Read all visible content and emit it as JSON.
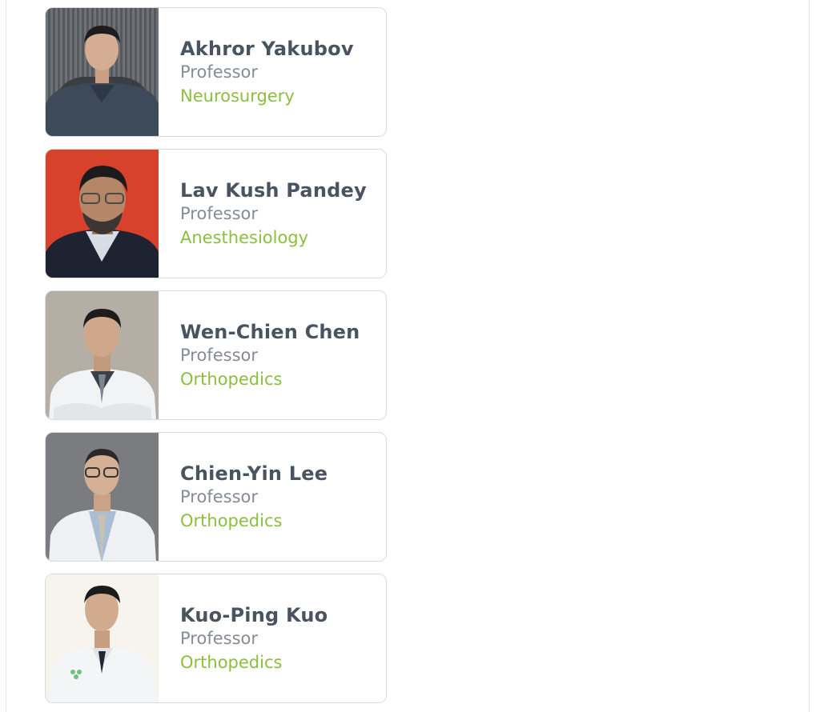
{
  "colors": {
    "name": "#4b5361",
    "title": "#858c96",
    "department": "#8cbf3f",
    "card_border": "#d9dcdf"
  },
  "doctors": [
    {
      "name": "Akhror Yakubov",
      "title": "Professor",
      "department": "Neurosurgery",
      "photo_icon": "doctor-photo-scrubs"
    },
    {
      "name": "Lav Kush Pandey",
      "title": "Professor",
      "department": "Anesthesiology",
      "photo_icon": "doctor-photo-suit"
    },
    {
      "name": "Wen-Chien Chen",
      "title": "Professor",
      "department": "Orthopedics",
      "photo_icon": "doctor-photo-whitecoat"
    },
    {
      "name": "Chien-Yin Lee",
      "title": "Professor",
      "department": "Orthopedics",
      "photo_icon": "doctor-photo-whitecoat"
    },
    {
      "name": "Kuo-Ping Kuo",
      "title": "Professor",
      "department": "Orthopedics",
      "photo_icon": "doctor-photo-whitecoat"
    }
  ]
}
